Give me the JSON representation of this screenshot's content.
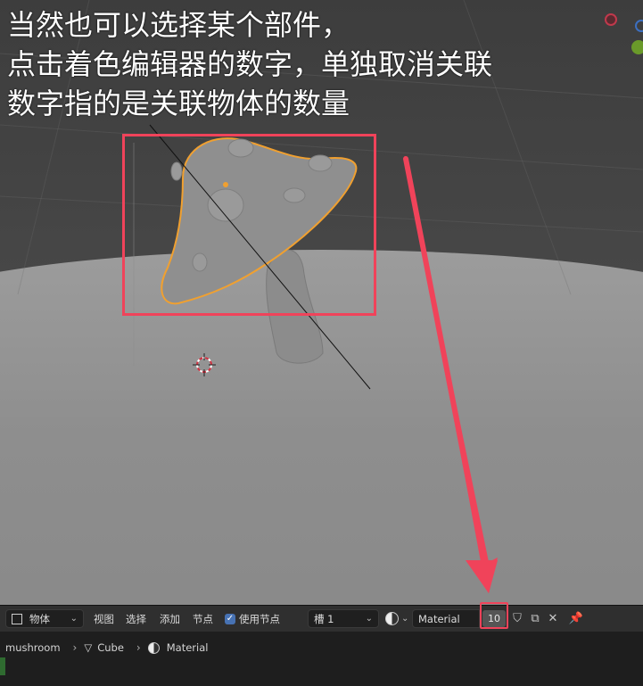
{
  "caption": {
    "line1": "当然也可以选择某个部件，",
    "line2": "点击着色编辑器的数字，单独取消关联",
    "line3": "数字指的是关联物体的数量"
  },
  "toolbar": {
    "mode_label": "物体",
    "menu_view": "视图",
    "menu_select": "选择",
    "menu_add": "添加",
    "menu_node": "节点",
    "use_nodes_label": "使用节点",
    "slot_label": "槽 1",
    "material_name": "Material",
    "user_count": "10"
  },
  "breadcrumb": {
    "object": "mushroom",
    "mesh": "Cube",
    "material": "Material"
  },
  "colors": {
    "annotation_red": "#f0435a",
    "selection_orange": "#f0a030",
    "accent_blue": "#4772b3"
  }
}
